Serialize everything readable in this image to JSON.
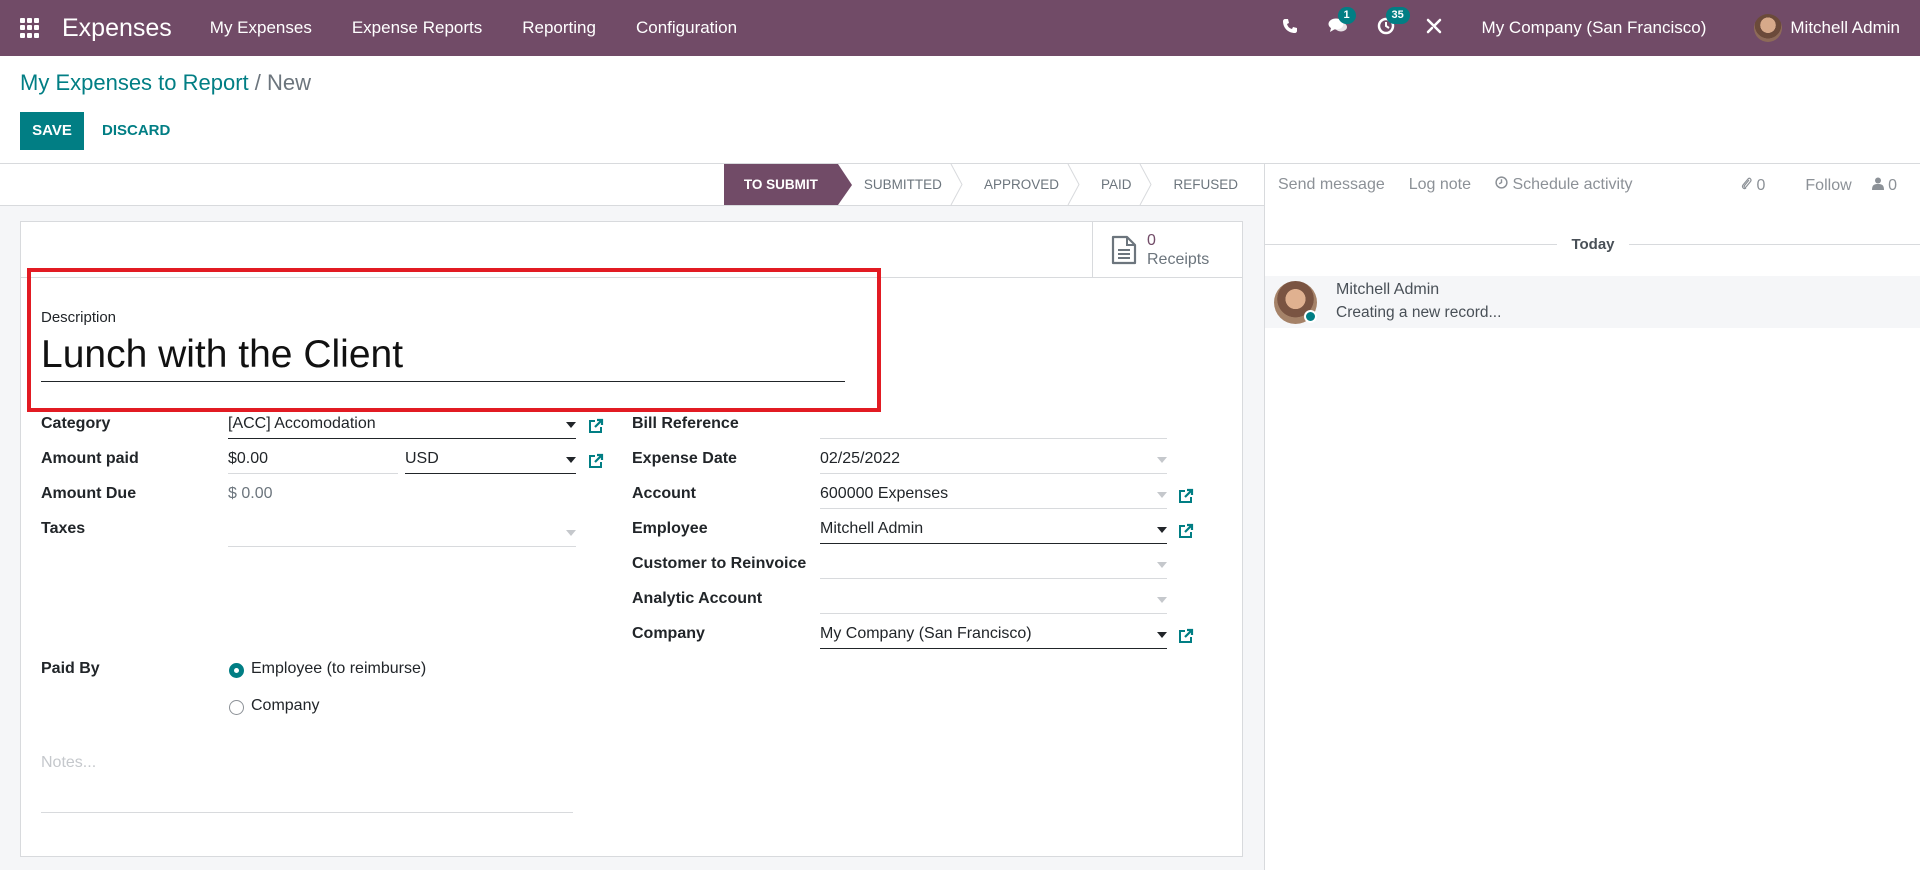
{
  "navbar": {
    "app_name": "Expenses",
    "menu": [
      {
        "label": "My Expenses"
      },
      {
        "label": "Expense Reports"
      },
      {
        "label": "Reporting"
      },
      {
        "label": "Configuration"
      }
    ],
    "messages_badge": "1",
    "activities_badge": "35",
    "company": "My Company (San Francisco)",
    "user": "Mitchell Admin"
  },
  "breadcrumb": {
    "parent": "My Expenses to Report",
    "separator": "/",
    "current": "New"
  },
  "actions": {
    "save_label": "SAVE",
    "discard_label": "DISCARD"
  },
  "statusbar": {
    "stages": [
      {
        "label": "TO SUBMIT",
        "active": true
      },
      {
        "label": "SUBMITTED",
        "active": false
      },
      {
        "label": "APPROVED",
        "active": false
      },
      {
        "label": "PAID",
        "active": false
      },
      {
        "label": "REFUSED",
        "active": false
      }
    ]
  },
  "stat_button": {
    "value": "0",
    "label": "Receipts"
  },
  "form": {
    "description_label": "Description",
    "description_value": "Lunch with the Client",
    "left": {
      "category_label": "Category",
      "category_value": "[ACC] Accomodation",
      "amount_paid_label": "Amount paid",
      "amount_paid_value": "$0.00",
      "currency_value": "USD",
      "amount_due_label": "Amount Due",
      "amount_due_value": "$ 0.00",
      "taxes_label": "Taxes",
      "taxes_value": "",
      "paid_by_label": "Paid By",
      "paid_by_options": [
        {
          "label": "Employee (to reimburse)",
          "checked": true
        },
        {
          "label": "Company",
          "checked": false
        }
      ],
      "notes_placeholder": "Notes..."
    },
    "right": {
      "bill_reference_label": "Bill Reference",
      "bill_reference_value": "",
      "expense_date_label": "Expense Date",
      "expense_date_value": "02/25/2022",
      "account_label": "Account",
      "account_value": "600000 Expenses",
      "employee_label": "Employee",
      "employee_value": "Mitchell Admin",
      "customer_label": "Customer to Reinvoice",
      "customer_value": "",
      "analytic_label": "Analytic Account",
      "analytic_value": "",
      "company_label": "Company",
      "company_value": "My Company (San Francisco)"
    }
  },
  "chatter": {
    "send_message": "Send message",
    "log_note": "Log note",
    "schedule_activity": "Schedule activity",
    "attachments_count": "0",
    "follow": "Follow",
    "followers_count": "0",
    "date_divider": "Today",
    "messages": [
      {
        "author": "Mitchell Admin",
        "body": "Creating a new record..."
      }
    ]
  },
  "colors": {
    "brand": "#714B67",
    "accent": "#017E84",
    "highlight": "#E21B23"
  }
}
